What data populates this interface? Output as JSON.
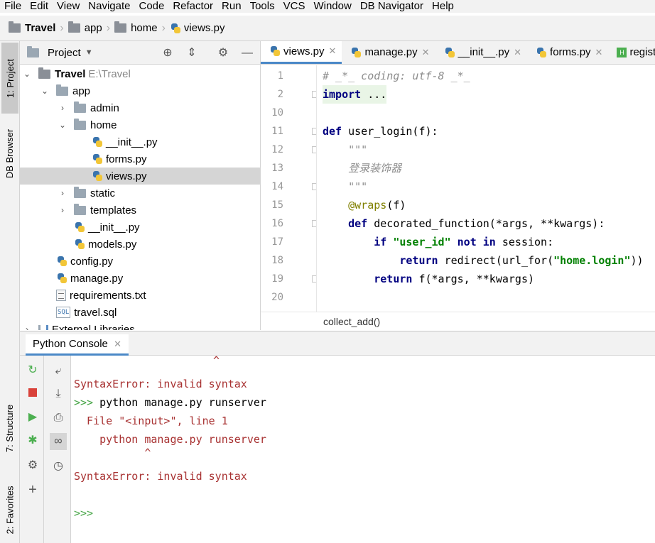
{
  "menu": [
    "File",
    "Edit",
    "View",
    "Navigate",
    "Code",
    "Refactor",
    "Run",
    "Tools",
    "VCS",
    "Window",
    "DB Navigator",
    "Help"
  ],
  "breadcrumb": [
    {
      "label": "Travel",
      "icon": "folder-icon"
    },
    {
      "label": "app",
      "icon": "folder-icon"
    },
    {
      "label": "home",
      "icon": "folder-icon"
    },
    {
      "label": "views.py",
      "icon": "python-file-icon"
    }
  ],
  "left_tool_tabs": {
    "project": "1: Project",
    "db_browser": "DB Browser",
    "structure": "7: Structure",
    "favorites": "2: Favorites"
  },
  "project_panel": {
    "title": "Project",
    "tree": [
      {
        "label": "Travel",
        "suffix": "E:\\Travel",
        "type": "folder",
        "expanded": true,
        "depth": 0,
        "bold": true
      },
      {
        "label": "app",
        "type": "folder",
        "expanded": true,
        "depth": 1
      },
      {
        "label": "admin",
        "type": "folder",
        "expanded": false,
        "depth": 2
      },
      {
        "label": "home",
        "type": "folder",
        "expanded": true,
        "depth": 2
      },
      {
        "label": "__init__.py",
        "type": "py",
        "depth": 3
      },
      {
        "label": "forms.py",
        "type": "py",
        "depth": 3
      },
      {
        "label": "views.py",
        "type": "py",
        "depth": 3,
        "selected": true
      },
      {
        "label": "static",
        "type": "folder",
        "expanded": false,
        "depth": 2
      },
      {
        "label": "templates",
        "type": "folder",
        "expanded": false,
        "depth": 2
      },
      {
        "label": "__init__.py",
        "type": "py",
        "depth": 2
      },
      {
        "label": "models.py",
        "type": "py",
        "depth": 2
      },
      {
        "label": "config.py",
        "type": "py",
        "depth": 1
      },
      {
        "label": "manage.py",
        "type": "py",
        "depth": 1
      },
      {
        "label": "requirements.txt",
        "type": "txt",
        "depth": 1
      },
      {
        "label": "travel.sql",
        "type": "sql",
        "depth": 1
      },
      {
        "label": "External Libraries",
        "type": "lib",
        "expanded": false,
        "depth": 0
      }
    ]
  },
  "editor": {
    "tabs": [
      {
        "label": "views.py",
        "active": true
      },
      {
        "label": "manage.py",
        "active": false
      },
      {
        "label": "__init__.py",
        "active": false
      },
      {
        "label": "forms.py",
        "active": false
      },
      {
        "label": "regist",
        "active": false
      }
    ],
    "line_numbers": [
      "1",
      "2",
      "10",
      "11",
      "12",
      "13",
      "14",
      "15",
      "16",
      "17",
      "18",
      "19",
      "20"
    ],
    "code_breadcrumb": "collect_add()"
  },
  "console": {
    "tab_label": "Python Console",
    "caret_line_top": "^",
    "error_1": "SyntaxError: invalid syntax",
    "prompt_symbol": ">>>",
    "command": " python manage.py runserver",
    "file_line": "  File \"<input>\", line 1",
    "echo_line": "    python manage.py runserver",
    "caret_line": "           ^",
    "error_2": "SyntaxError: invalid syntax",
    "empty_prompt": ">>>"
  },
  "colors": {
    "accent": "#4a88c7",
    "keyword": "#000080",
    "string": "#008000",
    "comment": "#8c8c8c",
    "decorator": "#808000",
    "error": "#a83232",
    "prompt": "#46a546"
  }
}
